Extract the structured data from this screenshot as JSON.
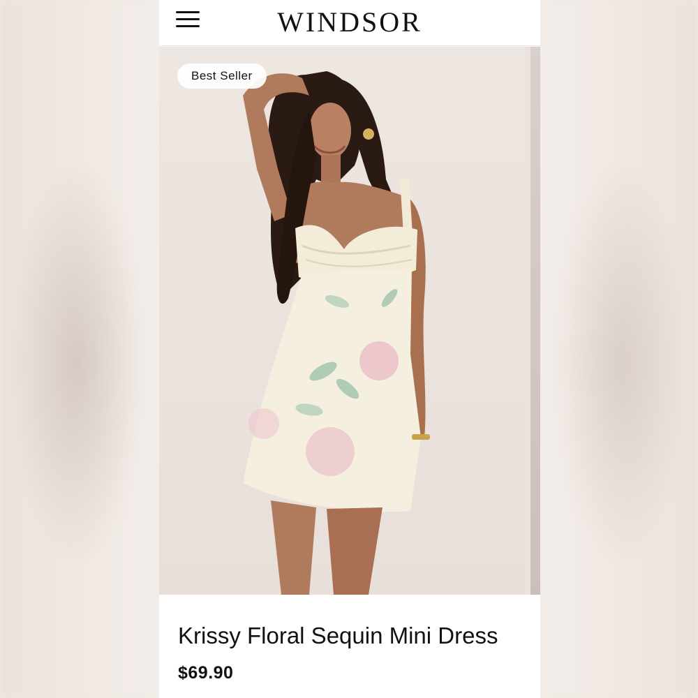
{
  "header": {
    "brand": "WINDSOR",
    "menu_icon": "hamburger-menu-icon"
  },
  "product": {
    "badge": "Best Seller",
    "image": "model-wearing-floral-sequin-mini-dress",
    "title": "Krissy Floral Sequin Mini Dress",
    "price": "$69.90"
  },
  "colors": {
    "background": "#ffffff",
    "text": "#111111",
    "photo_backdrop": "#ebe2dd",
    "dress_ivory": "#f4efdf",
    "floral_pink": "#e9b9c4",
    "floral_green": "#9fc3aa"
  }
}
